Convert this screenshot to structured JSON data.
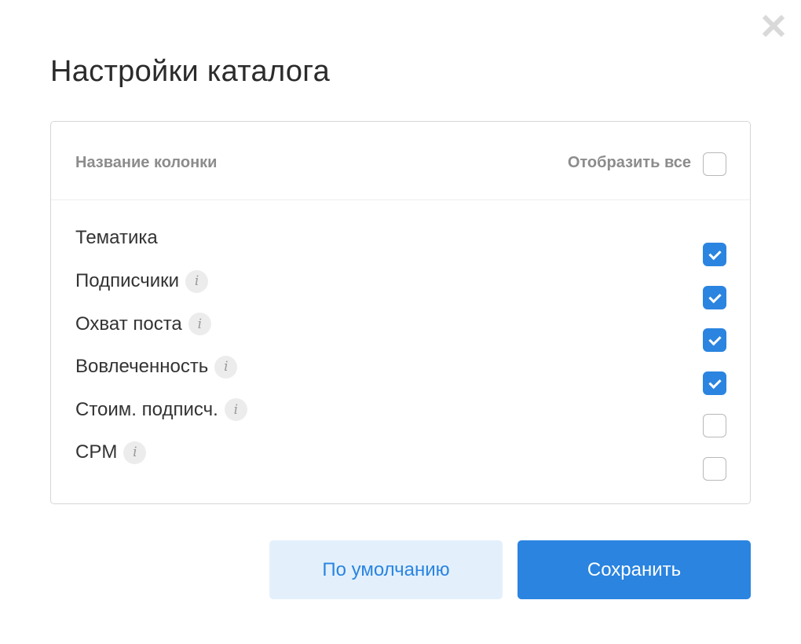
{
  "dialog": {
    "title": "Настройки каталога",
    "close_icon": "close-icon"
  },
  "table": {
    "column_header": "Название колонки",
    "show_all_label": "Отобразить все",
    "show_all_checked": false,
    "rows": [
      {
        "label": "Тематика",
        "info": false,
        "checked": true
      },
      {
        "label": "Подписчики",
        "info": true,
        "checked": true
      },
      {
        "label": "Охват поста",
        "info": true,
        "checked": true
      },
      {
        "label": "Вовлеченность",
        "info": true,
        "checked": true
      },
      {
        "label": "Стоим. подписч.",
        "info": true,
        "checked": false
      },
      {
        "label": "CPM",
        "info": true,
        "checked": false
      }
    ],
    "info_glyph": "i"
  },
  "buttons": {
    "default_label": "По умолчанию",
    "save_label": "Сохранить"
  },
  "colors": {
    "accent": "#2a84e0",
    "secondary_bg": "#e3f0fc"
  }
}
